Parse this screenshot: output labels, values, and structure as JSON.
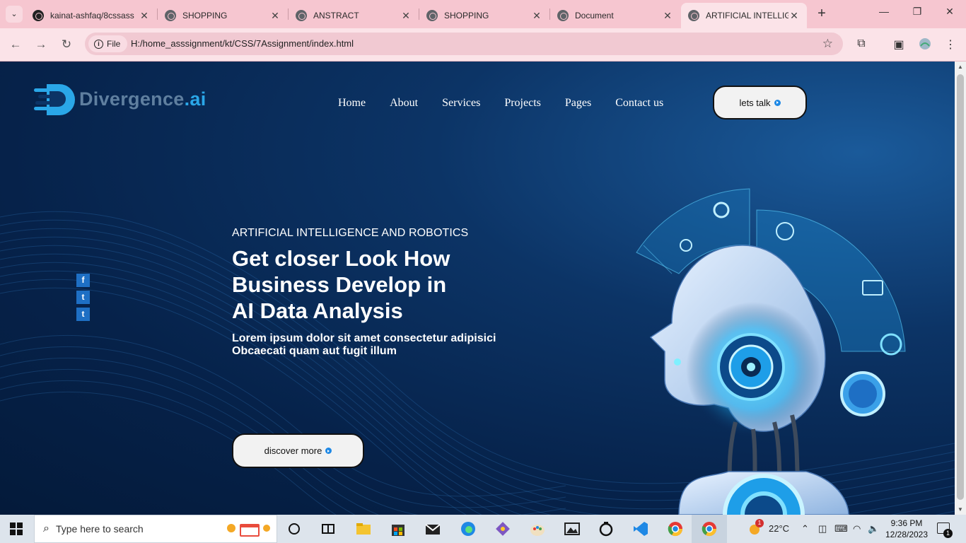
{
  "browser": {
    "tabs": [
      {
        "title": "kainat-ashfaq/8cssass",
        "icon": "github-icon"
      },
      {
        "title": "SHOPPING",
        "icon": "globe-icon"
      },
      {
        "title": "ANSTRACT",
        "icon": "globe-icon"
      },
      {
        "title": "SHOPPING",
        "icon": "globe-icon"
      },
      {
        "title": "Document",
        "icon": "globe-icon"
      },
      {
        "title": "ARTIFICIAL INTELLIGE",
        "icon": "globe-icon",
        "active": true
      }
    ],
    "new_tab": "+",
    "address": {
      "scheme_label": "File",
      "url": "H:/home_asssignment/kt/CSS/7Assignment/index.html"
    }
  },
  "site": {
    "logo": {
      "name": "Divergence",
      "suffix": ".ai"
    },
    "nav": [
      "Home",
      "About",
      "Services",
      "Projects",
      "Pages",
      "Contact us"
    ],
    "cta": "lets talk",
    "social": [
      "f",
      "t",
      "t"
    ],
    "hero": {
      "eyebrow": "ARTIFICIAL INTELLIGENCE AND ROBOTICS",
      "headline": [
        "Get closer Look How",
        "Business Develop in",
        "AI Data Analysis"
      ],
      "subtext": [
        "Lorem ipsum dolor sit amet consectetur adipisici",
        "Obcaecati quam aut fugit illum"
      ],
      "button": "discover more"
    }
  },
  "taskbar": {
    "search_placeholder": "Type here to search",
    "weather": "22°C",
    "weather_badge": "1",
    "time": "9:36 PM",
    "date": "12/28/2023",
    "notification_count": "1"
  },
  "colors": {
    "accent": "#2aa7e8",
    "page_bg": "#06224a",
    "tab_strip": "#f6c6d0"
  }
}
